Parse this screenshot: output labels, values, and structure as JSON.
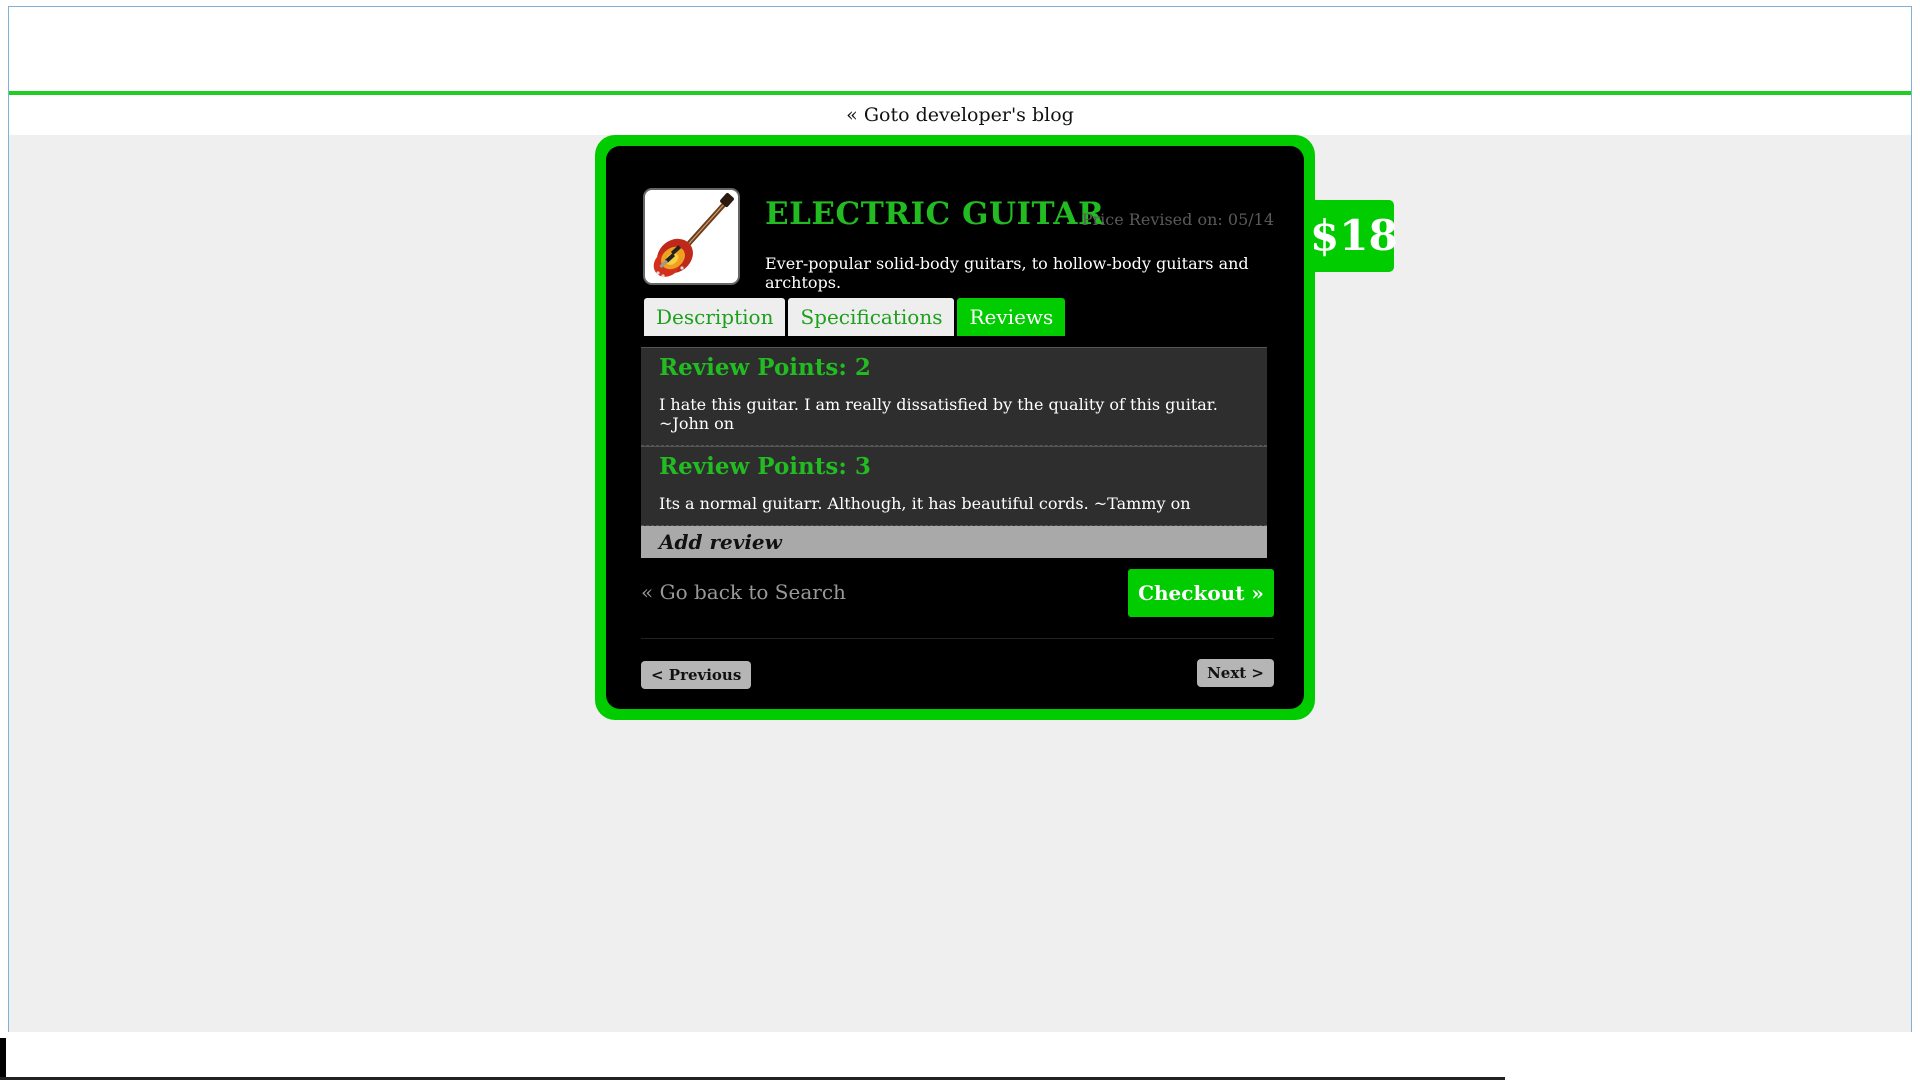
{
  "header": {
    "dev_blog_link": "« Goto developer's blog"
  },
  "product": {
    "title": "ELECTRIC GUITAR",
    "price_revised": "Price Revised on: 05/14",
    "subtitle": "Ever-popular solid-body guitars, to hollow-body guitars and archtops.",
    "price": "$18",
    "image_icon": "electric-guitar-icon"
  },
  "tabs": [
    {
      "label": "Description",
      "active": false
    },
    {
      "label": "Specifications",
      "active": false
    },
    {
      "label": "Reviews",
      "active": true
    }
  ],
  "reviews": [
    {
      "points": "Review Points: 2",
      "text": "I hate this guitar. I am really dissatisfied by the quality of this guitar. ~John on"
    },
    {
      "points": "Review Points: 3",
      "text": "Its a normal guitarr. Although, it has beautiful cords. ~Tammy on"
    }
  ],
  "add_review_label": "Add review",
  "nav": {
    "go_back": "« Go back to Search",
    "checkout": "Checkout »",
    "previous": "<  Previous",
    "next": "Next  >"
  },
  "colors": {
    "accent": "#00cc00",
    "card_bg": "#000000",
    "page_bg": "#efefef"
  }
}
